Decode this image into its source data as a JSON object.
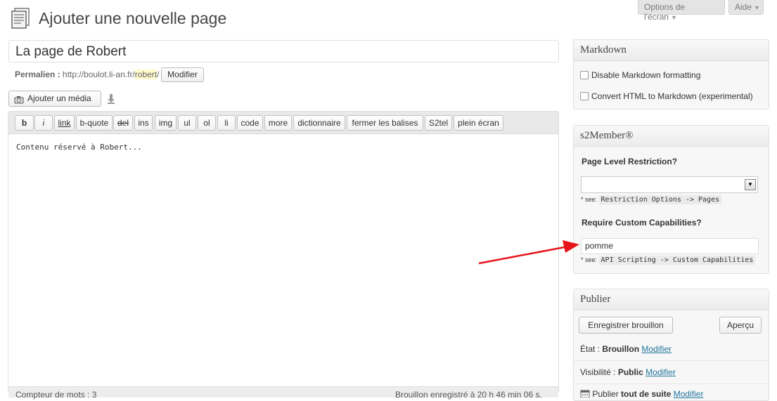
{
  "header": {
    "title": "Ajouter une nouvelle page",
    "screen_options": "Options de l'écran",
    "help": "Aide"
  },
  "post": {
    "title": "La page de Robert",
    "permalink_label": "Permalien :",
    "permalink_base": "http://boulot.li-an.fr/",
    "permalink_slug": "robert",
    "permalink_trail": "/",
    "modify_label": "Modifier"
  },
  "media": {
    "add_media_label": "Ajouter un média"
  },
  "editor": {
    "quicktags": [
      "b",
      "i",
      "link",
      "b-quote",
      "del",
      "ins",
      "img",
      "ul",
      "ol",
      "li",
      "code",
      "more",
      "dictionnaire",
      "fermer les balises",
      "S2tel",
      "plein écran"
    ],
    "content": "Contenu réservé à Robert...",
    "word_count": "Compteur de mots : 3",
    "draft_saved": "Brouillon enregistré à 20 h 46 min 06 s."
  },
  "markdown_box": {
    "title": "Markdown",
    "option1": "Disable Markdown formatting",
    "option2": "Convert HTML to Markdown (experimental)"
  },
  "s2member_box": {
    "title": "s2Member®",
    "restriction_label": "Page Level Restriction?",
    "restriction_value": "",
    "see_prefix": "* see:",
    "restriction_note": "Restriction Options -> Pages",
    "capabilities_label": "Require Custom Capabilities?",
    "capabilities_value": "pomme",
    "capabilities_note": "API Scripting -> Custom Capabilities"
  },
  "publish_box": {
    "title": "Publier",
    "save_draft": "Enregistrer brouillon",
    "preview": "Aperçu",
    "status_label": "État :",
    "status_value": "Brouillon",
    "visibility_label": "Visibilité :",
    "visibility_value": "Public",
    "publish_label": "Publier",
    "publish_value": "tout de suite",
    "modify_link": "Modifier"
  },
  "colors": {
    "link": "#21759b",
    "annotation_arrow": "#e8141b"
  }
}
